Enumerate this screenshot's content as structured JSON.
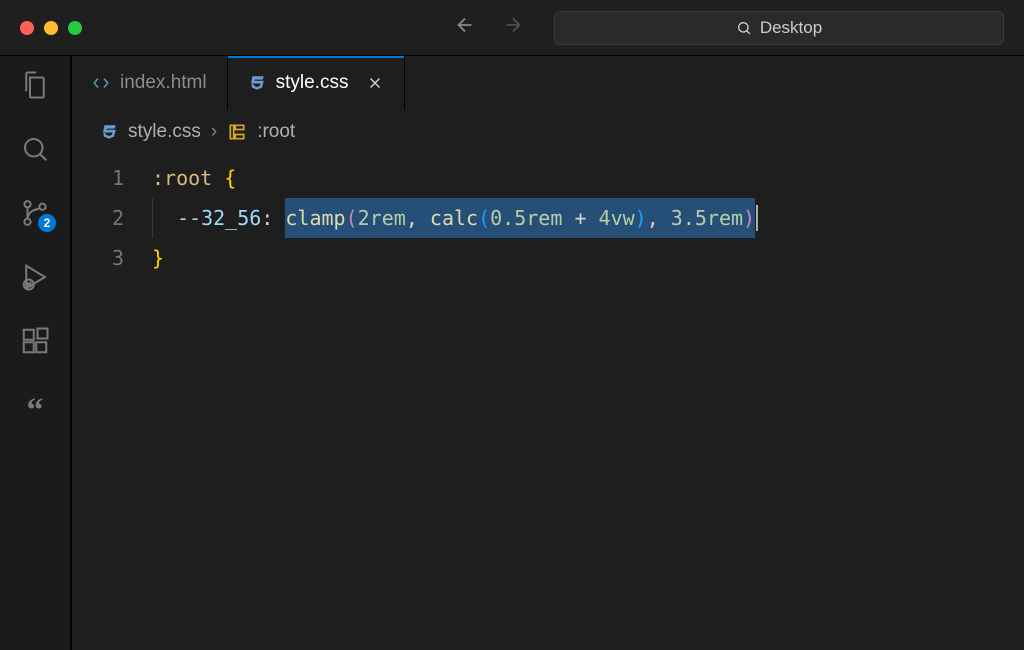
{
  "titlebar": {
    "search_text": "Desktop"
  },
  "activity": {
    "scm_badge": "2"
  },
  "tabs": [
    {
      "label": "index.html",
      "active": false
    },
    {
      "label": "style.css",
      "active": true
    }
  ],
  "breadcrumb": {
    "file": "style.css",
    "symbol": ":root"
  },
  "editor": {
    "lines": {
      "n1": "1",
      "n2": "2",
      "n3": "3"
    },
    "code": {
      "selector": ":root",
      "brace_open": "{",
      "var_name": "--32_56",
      "colon": ":",
      "func_clamp": "clamp",
      "val_2rem": "2rem",
      "comma1": ",",
      "func_calc": "calc",
      "val_05rem": "0.5rem",
      "plus": "+",
      "val_4vw": "4vw",
      "comma2": ",",
      "val_35rem": "3.5rem",
      "brace_close": "}"
    }
  }
}
